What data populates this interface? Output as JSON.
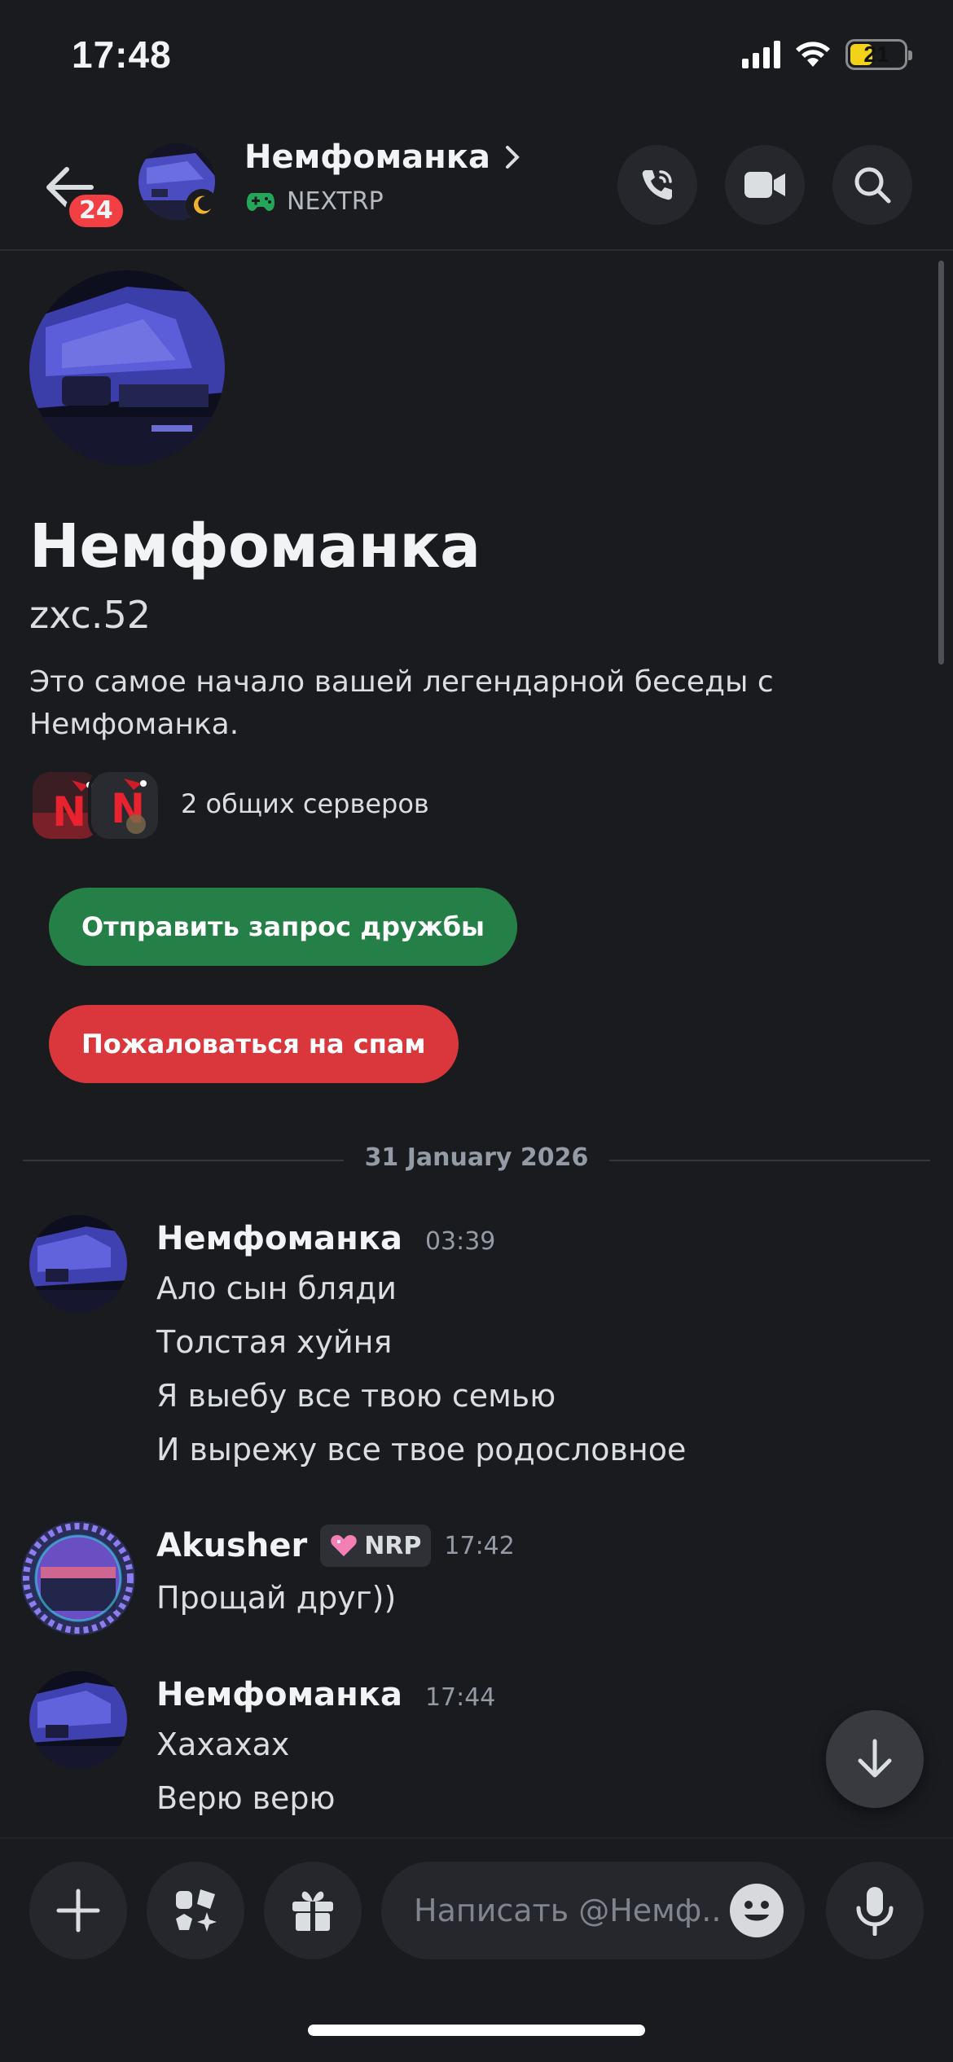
{
  "status_bar": {
    "time": "17:48",
    "battery": "21"
  },
  "header": {
    "back_badge": "24",
    "name": "Немфоманка",
    "activity": "NEXTRP"
  },
  "profile": {
    "display_name": "Немфоманка",
    "username": "zxc.52",
    "intro": "Это самое начало вашей легендарной беседы с Немфоманка.",
    "mutual_servers": "2 общих серверов",
    "add_friend_label": "Отправить запрос дружбы",
    "report_spam_label": "Пожаловаться на спам"
  },
  "date_divider": "31 January 2026",
  "messages": [
    {
      "author": "Немфоманка",
      "time": "03:39",
      "lines": [
        "Ало сын бляди",
        "Толстая хуйня",
        "Я выебу все твою семью",
        "И вырежу все твое родословное"
      ]
    },
    {
      "author": "Akusher",
      "role": "NRP",
      "time": "17:42",
      "lines": [
        "Прощай друг))"
      ]
    },
    {
      "author": "Немфоманка",
      "time": "17:44",
      "lines": [
        "Хахахах",
        "Верю верю"
      ]
    }
  ],
  "composer": {
    "placeholder": "Написать @Немф.."
  },
  "colors": {
    "accent_green": "#248046",
    "accent_red": "#da373c",
    "badge_red": "#f23f43",
    "background": "#1a1b1f"
  }
}
